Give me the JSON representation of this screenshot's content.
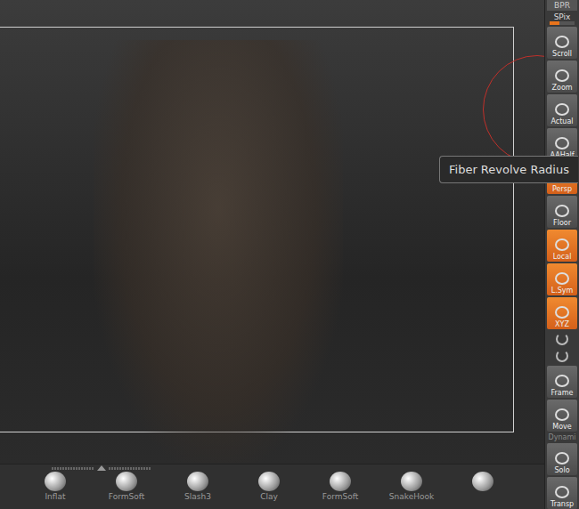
{
  "viewport": {
    "render": "3D model preview"
  },
  "tooltip": {
    "text": "Fiber Revolve Radius"
  },
  "shelf": {
    "top_label": "BPR",
    "spix": {
      "label": "SPix",
      "level": 0.4
    },
    "buttons": [
      {
        "kind": "button",
        "label": "Scroll",
        "selected": false
      },
      {
        "kind": "button",
        "label": "Zoom",
        "selected": false
      },
      {
        "kind": "button",
        "label": "Actual",
        "selected": false
      },
      {
        "kind": "button",
        "label": "AAHalf",
        "selected": false
      },
      {
        "kind": "button",
        "label": "Persp",
        "selected": true
      },
      {
        "kind": "button",
        "label": "Floor",
        "selected": false
      },
      {
        "kind": "button",
        "label": "Local",
        "selected": true
      },
      {
        "kind": "button",
        "label": "L.Sym",
        "selected": true
      },
      {
        "kind": "button",
        "label": "XYZ",
        "selected": true
      },
      {
        "kind": "icon",
        "label": "",
        "selected": false
      },
      {
        "kind": "icon",
        "label": "",
        "selected": false
      },
      {
        "kind": "button",
        "label": "Frame",
        "selected": false
      },
      {
        "kind": "button",
        "label": "Move",
        "selected": false
      },
      {
        "kind": "caption",
        "label": "Dynami",
        "selected": false
      },
      {
        "kind": "button",
        "label": "Solo",
        "selected": false
      },
      {
        "kind": "button",
        "label": "Transp",
        "selected": false
      }
    ]
  },
  "brushes": [
    {
      "label": ""
    },
    {
      "label": "Inflat"
    },
    {
      "label": "FormSoft"
    },
    {
      "label": "Slash3"
    },
    {
      "label": "Clay"
    },
    {
      "label": "FormSoft"
    },
    {
      "label": "SnakeHook"
    },
    {
      "label": ""
    }
  ]
}
